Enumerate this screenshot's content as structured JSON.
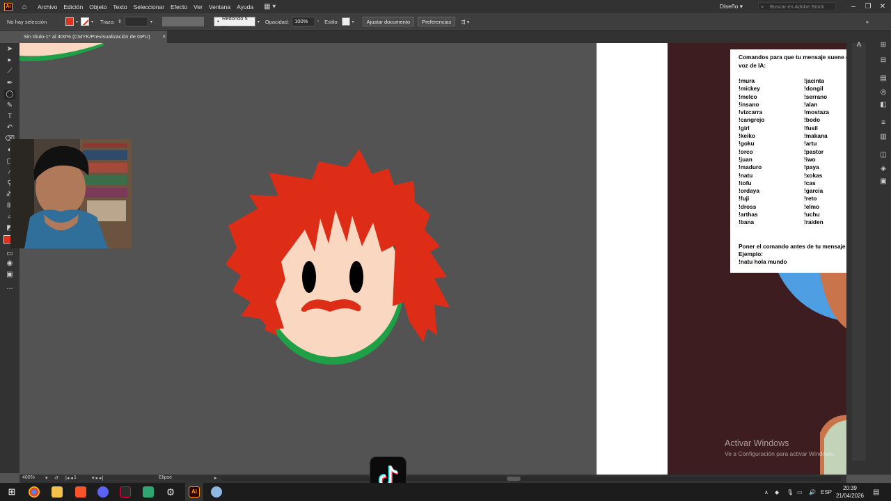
{
  "menubar": {
    "app_logo": "Ai",
    "items": [
      "Archivo",
      "Edición",
      "Objeto",
      "Texto",
      "Seleccionar",
      "Efecto",
      "Ver",
      "Ventana",
      "Ayuda"
    ],
    "workspace": "Diseño",
    "stock_placeholder": "Buscar en Adobe Stock"
  },
  "controlbar": {
    "selection": "No hay selección",
    "stroke_label": "Trazo:",
    "brush": "Redondo 5 ...",
    "opacity_label": "Opacidad:",
    "opacity_value": "100%",
    "style_label": "Estilo:",
    "fit_button": "Ajustar documento",
    "prefs_button": "Preferencias",
    "fill_color": "#e1301c"
  },
  "tab": {
    "title": "Sin título-1* al 400% (CMYK/Previsualización de GPU)",
    "close": "×"
  },
  "note": {
    "heading": "Comandos para que tu mensaje suene con una voz de IA:",
    "col1": [
      "!mura",
      "!mickey",
      "!melco",
      "!insano",
      "!vizcarra",
      "!cangrejo",
      "!girl",
      "!keiko",
      "!goku",
      "!orco",
      "!juan",
      "!maduro",
      "!natu",
      "!tofu",
      "!ordaya",
      "!fuji",
      "!dross",
      "!arthas",
      "!bana"
    ],
    "col2": [
      "!jacinta",
      "!dongil",
      "!serrano",
      "!alan",
      "!mostaza",
      "!bodo",
      "!fusil",
      "!makana",
      "!artu",
      "!pastor",
      "!iwo",
      "!paya",
      "!xokas",
      "!cas",
      "!garcia",
      "!reto",
      "!elmo",
      "!uchu",
      "!raiden"
    ],
    "footer_line1": "Poner el comando antes de tu mensaje",
    "footer_line2": "Ejemplo:",
    "footer_line3": "!natu hola mundo"
  },
  "statusbar": {
    "zoom": "400%",
    "page": "1",
    "tool": "Elipse"
  },
  "watermark": {
    "title": "Activar Windows",
    "subtitle": "Ve a Configuración para activar Windows."
  },
  "taskbar": {
    "language": "ESP",
    "time": "20:39",
    "date": "21/04/2026"
  },
  "colors": {
    "hair": "#dd2d16",
    "face": "#fad7c0",
    "collar": "#1fa046",
    "eyes": "#000000",
    "artboard_dark": "#3d1d1f"
  }
}
